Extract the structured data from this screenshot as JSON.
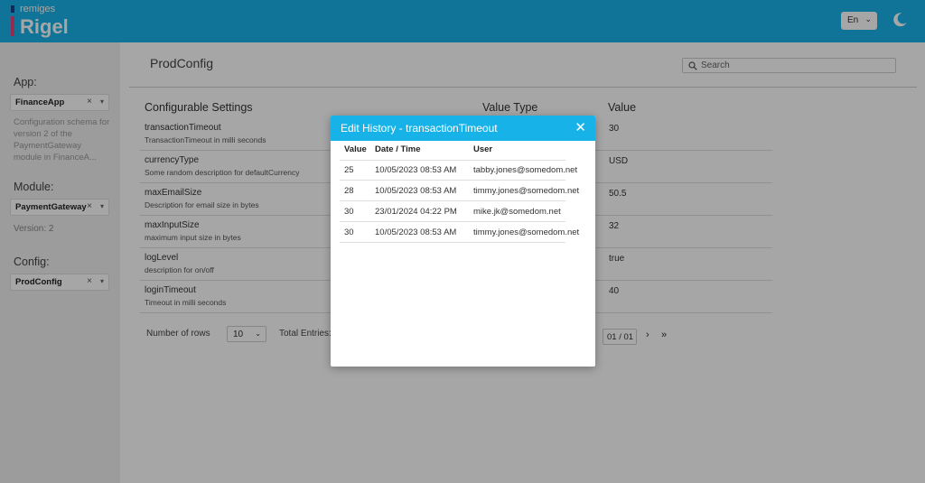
{
  "header": {
    "brand_small": "remiges",
    "brand_large": "Rigel",
    "language": "En"
  },
  "sidebar": {
    "app_label": "App:",
    "app_value": "FinanceApp",
    "app_description": "Configuration schema for version 2 of the PaymentGateway module in FinanceA...",
    "module_label": "Module:",
    "module_value": "PaymentGateway",
    "version": "Version: 2",
    "config_label": "Config:",
    "config_value": "ProdConfig",
    "clear_glyph": "×",
    "caret_glyph": "▾"
  },
  "main": {
    "title": "ProdConfig",
    "search_placeholder": "Search",
    "columns": {
      "setting": "Configurable Settings",
      "value_type": "Value Type",
      "value": "Value"
    },
    "rows": [
      {
        "name": "transactionTimeout",
        "description": "TransactionTimeout in milli seconds",
        "value": "30"
      },
      {
        "name": "currencyType",
        "description": "Some random description for defaultCurrency",
        "value": "USD"
      },
      {
        "name": "maxEmailSize",
        "description": "Description for email size in bytes",
        "value": "50.5"
      },
      {
        "name": "maxInputSize",
        "description": "maximum input size in bytes",
        "value": "32"
      },
      {
        "name": "logLevel",
        "description": "description for on/off",
        "value": "true"
      },
      {
        "name": "loginTimeout",
        "description": "Timeout in milli seconds",
        "value": "40"
      }
    ],
    "footer": {
      "rows_label": "Number of rows",
      "rows_value": "10",
      "entries_label": "Total Entries:",
      "page": "01 / 01",
      "next": "›",
      "last": "»"
    }
  },
  "modal": {
    "title": "Edit History - transactionTimeout",
    "close_glyph": "✕",
    "columns": {
      "value": "Value",
      "datetime": "Date / Time",
      "user": "User"
    },
    "rows": [
      {
        "value": "25",
        "datetime": "10/05/2023 08:53 AM",
        "user": "tabby.jones@somedom.net"
      },
      {
        "value": "28",
        "datetime": "10/05/2023 08:53 AM",
        "user": "timmy.jones@somedom.net"
      },
      {
        "value": "30",
        "datetime": "23/01/2024 04:22 PM",
        "user": "mike.jk@somedom.net"
      },
      {
        "value": "30",
        "datetime": "10/05/2023 08:53 AM",
        "user": "timmy.jones@somedom.net"
      }
    ]
  },
  "colors": {
    "accent": "#17b3e8",
    "logo_dark": "#1d3f8a",
    "logo_pink": "#e8437a"
  },
  "icons": [
    "moon-icon",
    "search-icon",
    "close-icon",
    "chevron-down-icon"
  ]
}
